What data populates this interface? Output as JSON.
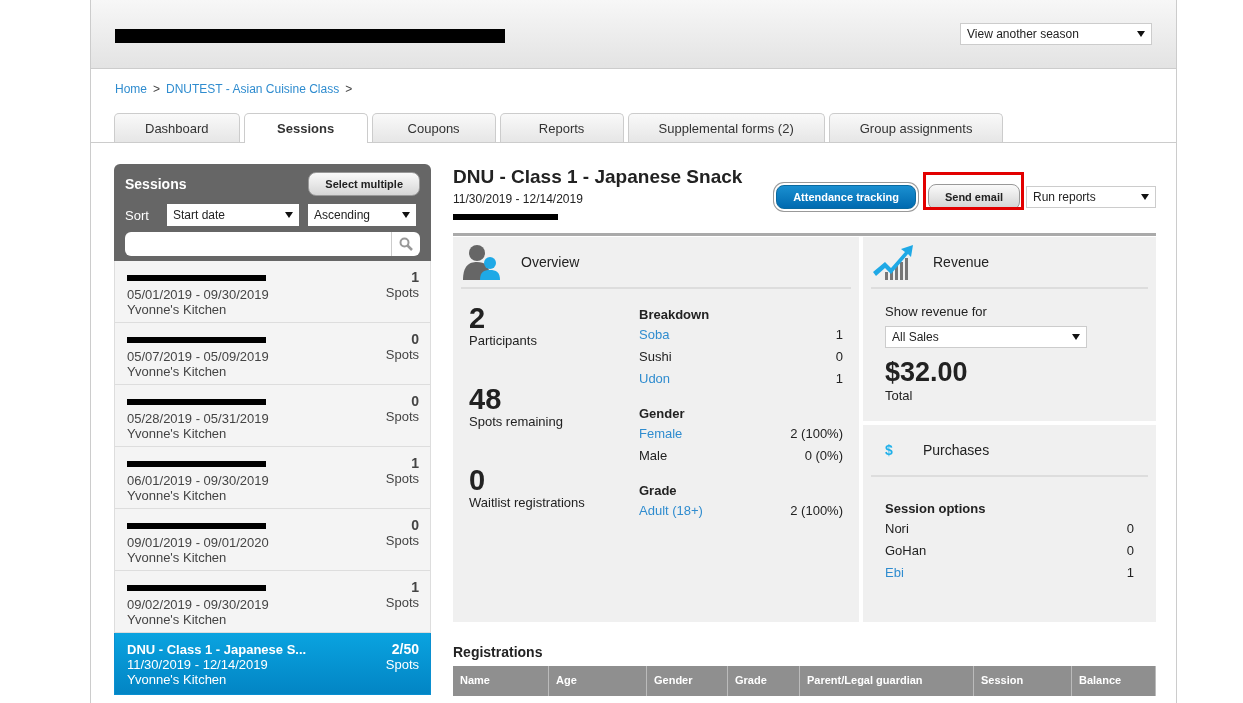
{
  "header": {
    "title_redacted": true,
    "season_select": "View another season"
  },
  "breadcrumb": {
    "items": [
      "Home",
      "DNUTEST - Asian Cuisine Class"
    ],
    "separator": ">"
  },
  "tabs": [
    {
      "label": "Dashboard",
      "selected": false
    },
    {
      "label": "Sessions",
      "selected": true
    },
    {
      "label": "Coupons",
      "selected": false
    },
    {
      "label": "Reports",
      "selected": false
    },
    {
      "label": "Supplemental forms (2)",
      "selected": false
    },
    {
      "label": "Group assignments",
      "selected": false
    }
  ],
  "sidebar": {
    "title": "Sessions",
    "select_button": "Select multiple",
    "sort_label": "Sort",
    "sort_field": "Start date",
    "sort_order": "Ascending",
    "sessions": [
      {
        "dates": "05/01/2019 - 09/30/2019",
        "location": "Yvonne's Kitchen",
        "spots": "1",
        "spots_label": "Spots",
        "selected": false
      },
      {
        "dates": "05/07/2019 - 05/09/2019",
        "location": "Yvonne's Kitchen",
        "spots": "0",
        "spots_label": "Spots",
        "selected": false
      },
      {
        "dates": "05/28/2019 - 05/31/2019",
        "location": "Yvonne's Kitchen",
        "spots": "0",
        "spots_label": "Spots",
        "selected": false
      },
      {
        "dates": "06/01/2019 - 09/30/2019",
        "location": "Yvonne's Kitchen",
        "spots": "1",
        "spots_label": "Spots",
        "selected": false
      },
      {
        "dates": "09/01/2019 - 09/01/2020",
        "location": "Yvonne's Kitchen",
        "spots": "0",
        "spots_label": "Spots",
        "selected": false
      },
      {
        "dates": "09/02/2019 - 09/30/2019",
        "location": "Yvonne's Kitchen",
        "spots": "1",
        "spots_label": "Spots",
        "selected": false
      },
      {
        "name": "DNU - Class 1 - Japanese S...",
        "dates": "11/30/2019 - 12/14/2019",
        "location": "Yvonne's Kitchen",
        "spots": "2/50",
        "spots_label": "Spots",
        "selected": true
      }
    ]
  },
  "session": {
    "title": "DNU - Class 1 - Japanese Snack",
    "dates": "11/30/2019 - 12/14/2019",
    "location_redacted": true,
    "buttons": [
      {
        "label": "Attendance tracking",
        "kind": "primary",
        "highlighted": false
      },
      {
        "label": "Send email",
        "kind": "secondary",
        "highlighted": true
      }
    ],
    "reports_select": "Run reports"
  },
  "overview": {
    "title": "Overview",
    "stats": [
      {
        "value": "2",
        "label": "Participants"
      },
      {
        "value": "48",
        "label": "Spots remaining"
      },
      {
        "value": "0",
        "label": "Waitlist registrations"
      }
    ],
    "groups": [
      {
        "heading": "Breakdown",
        "rows": [
          {
            "label": "Soba",
            "value": "1",
            "link": true
          },
          {
            "label": "Sushi",
            "value": "0",
            "link": false
          },
          {
            "label": "Udon",
            "value": "1",
            "link": true
          }
        ]
      },
      {
        "heading": "Gender",
        "rows": [
          {
            "label": "Female",
            "value": "2 (100%)",
            "link": true
          },
          {
            "label": "Male",
            "value": "0 (0%)",
            "link": false
          }
        ]
      },
      {
        "heading": "Grade",
        "rows": [
          {
            "label": "Adult (18+)",
            "value": "2 (100%)",
            "link": true
          }
        ]
      }
    ]
  },
  "revenue": {
    "title": "Revenue",
    "filter_label": "Show revenue for",
    "filter": "All Sales",
    "amount": "$32.00",
    "amount_label": "Total"
  },
  "purchases": {
    "title": "Purchases",
    "icon": "$",
    "heading": "Session options",
    "rows": [
      {
        "label": "Nori",
        "value": "0",
        "link": false
      },
      {
        "label": "GoHan",
        "value": "0",
        "link": false
      },
      {
        "label": "Ebi",
        "value": "1",
        "link": true
      }
    ]
  },
  "registrations": {
    "title": "Registrations",
    "columns": [
      "Name",
      "Age",
      "Gender",
      "Grade",
      "Parent/Legal guardian",
      "Session",
      "Balance"
    ]
  }
}
